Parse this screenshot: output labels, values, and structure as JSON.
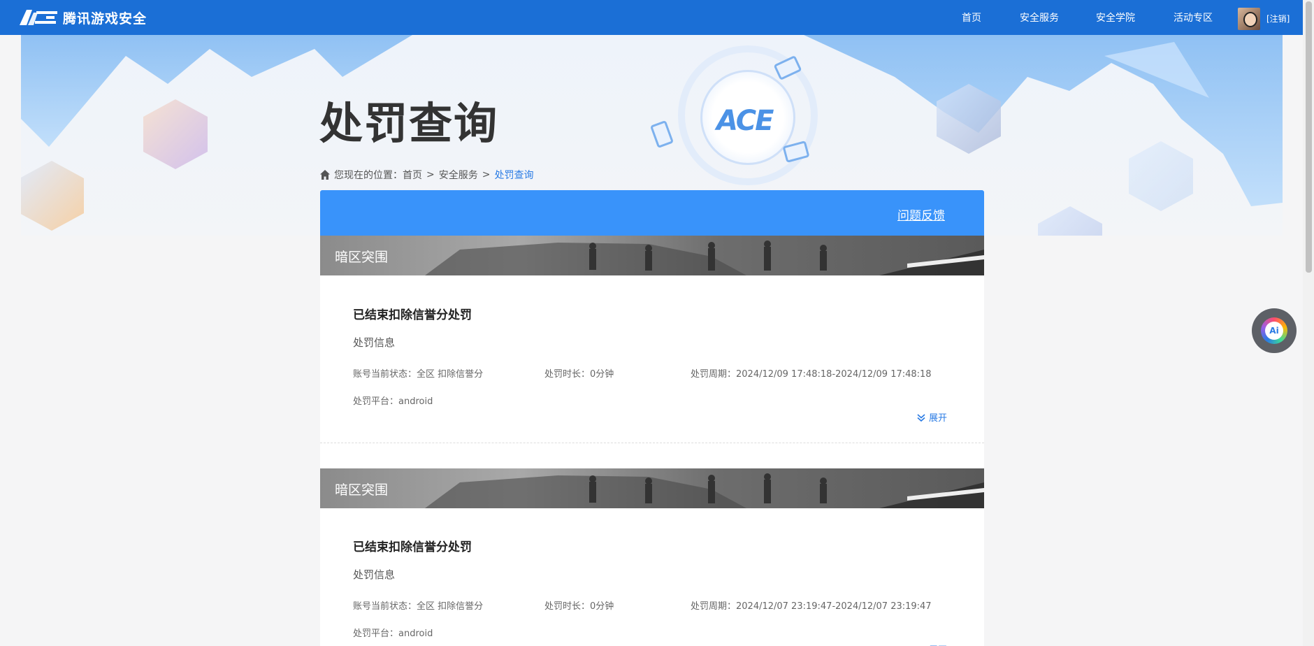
{
  "header": {
    "logo_text": "腾讯游戏安全",
    "logo_mark": "ACE",
    "nav": [
      "首页",
      "安全服务",
      "安全学院",
      "活动专区"
    ],
    "logout": "[注销]"
  },
  "banner": {
    "title": "处罚查询",
    "breadcrumb": {
      "prefix": "您现在的位置：",
      "items": [
        "首页",
        "安全服务"
      ],
      "current": "处罚查询"
    }
  },
  "panel": {
    "feedback": "问题反馈"
  },
  "records": [
    {
      "game": "暗区突围",
      "title": "已结束扣除信誉分处罚",
      "subtitle": "处罚信息",
      "status": "账号当前状态：全区 扣除信誉分",
      "duration": "处罚时长：0分钟",
      "period": "处罚周期：2024/12/09 17:48:18-2024/12/09 17:48:18",
      "platform": "处罚平台：android",
      "expand": "展开"
    },
    {
      "game": "暗区突围",
      "title": "已结束扣除信誉分处罚",
      "subtitle": "处罚信息",
      "status": "账号当前状态：全区 扣除信誉分",
      "duration": "处罚时长：0分钟",
      "period": "处罚周期：2024/12/07 23:19:47-2024/12/07 23:19:47",
      "platform": "处罚平台：android",
      "expand": "展开"
    }
  ],
  "ai_button": "Ai",
  "colors": {
    "topbar": "#1b6fd6",
    "panel_head": "#3993fa",
    "link": "#2a7be4"
  }
}
